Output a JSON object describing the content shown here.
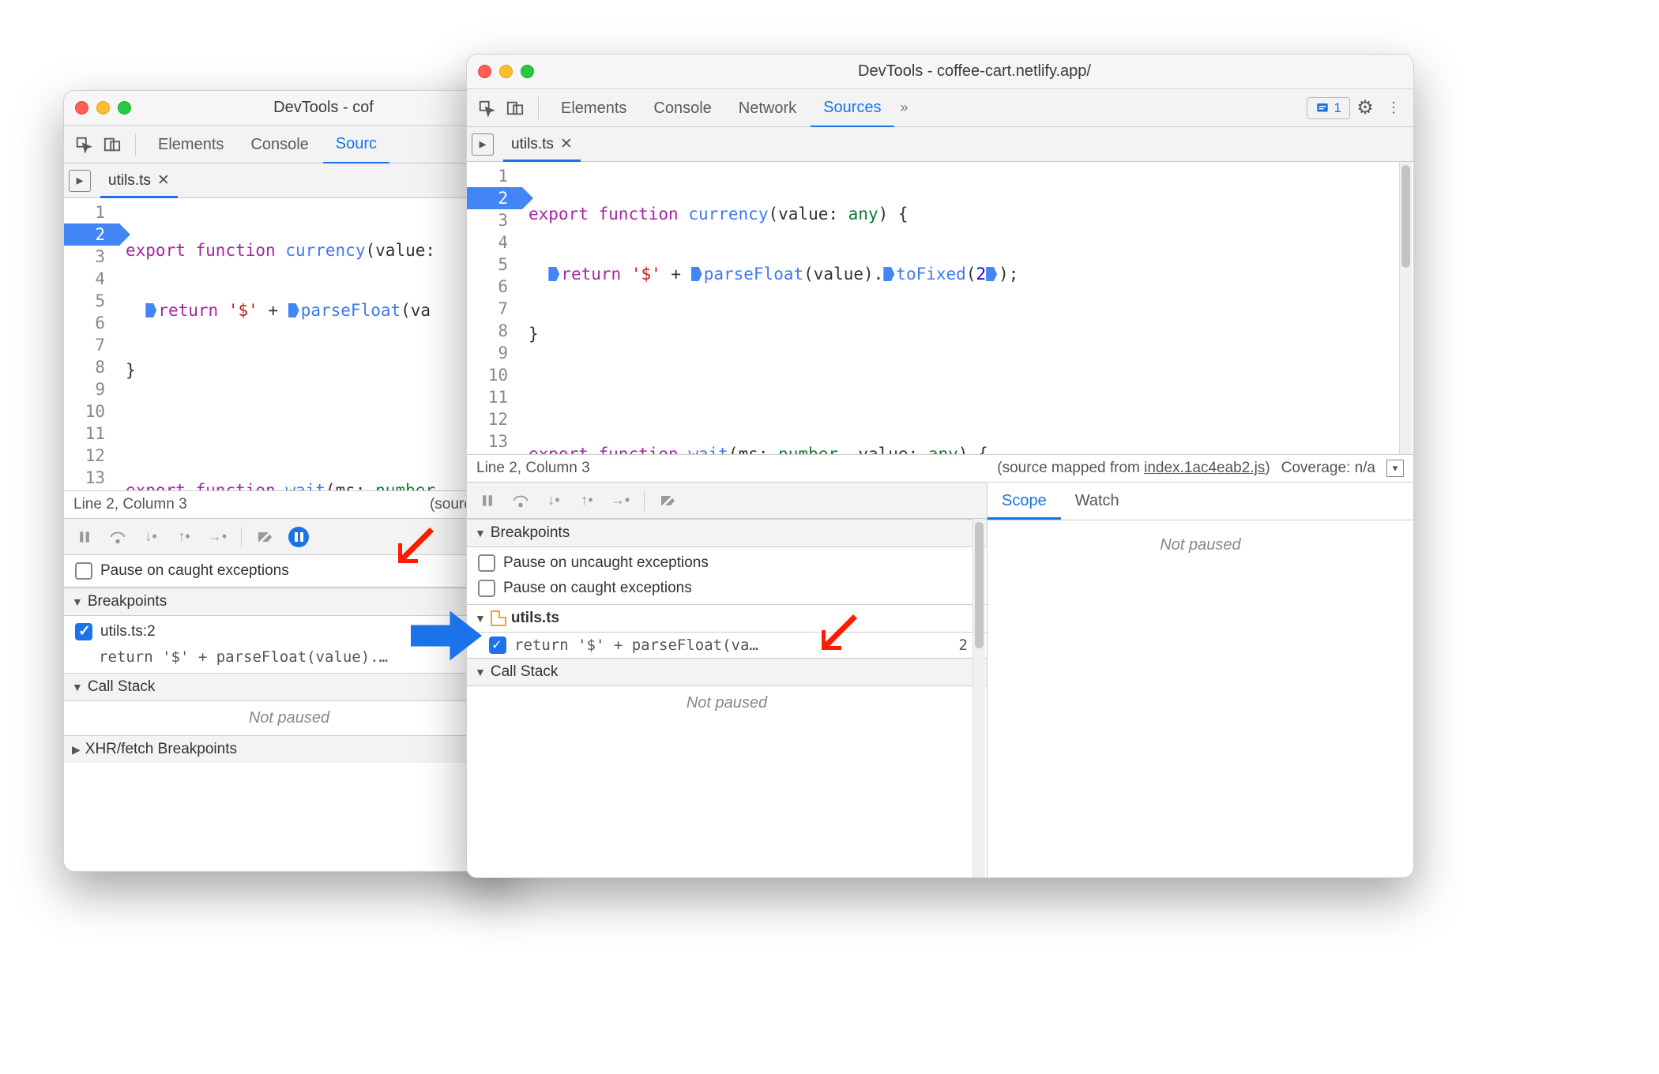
{
  "left_window": {
    "title": "DevTools - cof",
    "tabs": [
      "Elements",
      "Console",
      "Sourc"
    ],
    "active_tab_index": 2,
    "file_tab": {
      "name": "utils.ts"
    },
    "line_status": "Line 2, Column 3",
    "source_mapped_text": "(source ma",
    "code": {
      "lines": [
        "1",
        "2",
        "3",
        "4",
        "5",
        "6",
        "7",
        "8",
        "9",
        "10",
        "11",
        "12",
        "13"
      ],
      "bp_line": 2
    },
    "dbg": {
      "pause_caught": "Pause on caught exceptions",
      "breakpoints_label": "Breakpoints",
      "bp_file": "utils.ts:2",
      "bp_code": "return '$' + parseFloat(value).…",
      "callstack_label": "Call Stack",
      "not_paused": "Not paused",
      "xhr_label": "XHR/fetch Breakpoints"
    }
  },
  "right_window": {
    "title": "DevTools - coffee-cart.netlify.app/",
    "tabs": [
      "Elements",
      "Console",
      "Network",
      "Sources"
    ],
    "active_tab_index": 3,
    "issues_count": "1",
    "file_tab": {
      "name": "utils.ts"
    },
    "line_status": "Line 2, Column 3",
    "source_mapped_prefix": "(source mapped from ",
    "source_mapped_file": "index.1ac4eab2.js",
    "source_mapped_suffix": ")",
    "coverage": "Coverage: n/a",
    "code": {
      "bp_line": 2
    },
    "scope_tab": "Scope",
    "watch_tab": "Watch",
    "not_paused": "Not paused",
    "dbg": {
      "breakpoints_label": "Breakpoints",
      "pause_uncaught": "Pause on uncaught exceptions",
      "pause_caught": "Pause on caught exceptions",
      "bp_group_file": "utils.ts",
      "bp_code": "return '$' + parseFloat(va…",
      "bp_line_num": "2",
      "callstack_label": "Call Stack",
      "not_paused": "Not paused"
    }
  }
}
